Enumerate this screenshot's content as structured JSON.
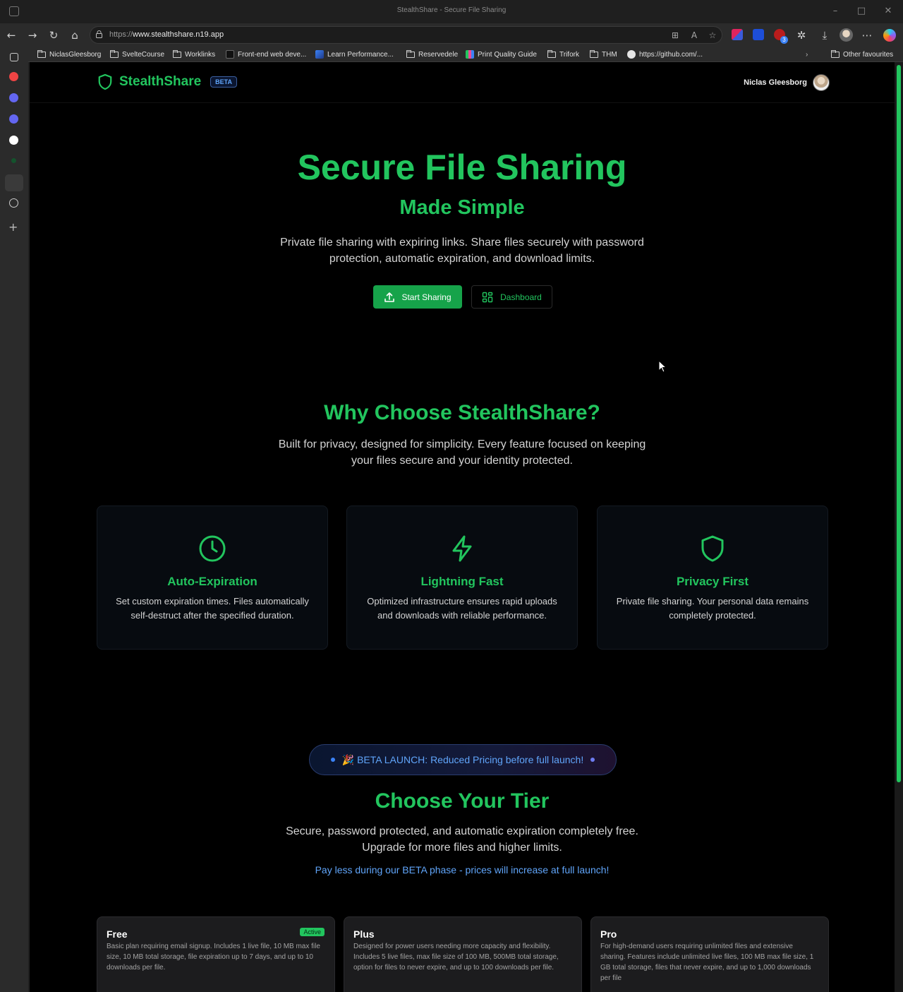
{
  "browser": {
    "window_title": "StealthShare - Secure File Sharing",
    "url_proto": "https://",
    "url_rest": "www.stealthshare.n19.app",
    "bookmarks": [
      "NiclasGleesborg",
      "SvelteCourse",
      "Worklinks",
      "Front-end web deve...",
      "Learn Performance...",
      "Reservedele",
      "Print Quality Guide",
      "Trifork",
      "THM",
      "https://github.com/..."
    ],
    "other_favourites": "Other favourites",
    "ext_badge": "3"
  },
  "header": {
    "brand": "StealthShare",
    "badge": "BETA",
    "user_name": "Niclas Gleesborg"
  },
  "hero": {
    "title": "Secure File Sharing",
    "subtitle": "Made Simple",
    "description": "Private file sharing with expiring links. Share files securely with password protection, automatic expiration, and download limits.",
    "primary_button": "Start Sharing",
    "secondary_button": "Dashboard"
  },
  "why": {
    "title": "Why Choose StealthShare?",
    "description": "Built for privacy, designed for simplicity. Every feature focused on keeping your files secure and your identity protected.",
    "features": [
      {
        "icon": "clock-icon",
        "title": "Auto-Expiration",
        "description": "Set custom expiration times. Files automatically self-destruct after the specified duration."
      },
      {
        "icon": "lightning-icon",
        "title": "Lightning Fast",
        "description": "Optimized infrastructure ensures rapid uploads and downloads with reliable performance."
      },
      {
        "icon": "shield-icon",
        "title": "Privacy First",
        "description": "Private file sharing. Your personal data remains completely protected."
      }
    ]
  },
  "pricing": {
    "banner": "🎉 BETA LAUNCH: Reduced Pricing before full launch!",
    "title": "Choose Your Tier",
    "description": "Secure, password protected, and automatic expiration completely free. Upgrade for more files and higher limits.",
    "note": "Pay less during our BETA phase - prices will increase at full launch!",
    "plans": [
      {
        "name": "Free",
        "badge": "Active",
        "description": "Basic plan requiring email signup. Includes 1 live file, 10 MB max file size, 10 MB total storage, file expiration up to 7 days, and up to 10 downloads per file."
      },
      {
        "name": "Plus",
        "description": "Designed for power users needing more capacity and flexibility. Includes 5 live files, max file size of 100 MB, 500MB total storage, option for files to never expire, and up to 100 downloads per file."
      },
      {
        "name": "Pro",
        "description": "For high-demand users requiring unlimited files and extensive sharing. Features include unlimited live files, 100 MB max file size, 1 GB total storage, files that never expire, and up to 1,000 downloads per file"
      }
    ]
  },
  "colors": {
    "accent": "#22c55e",
    "accent_dark": "#16a34a",
    "info": "#60a5fa",
    "background": "#000000"
  }
}
